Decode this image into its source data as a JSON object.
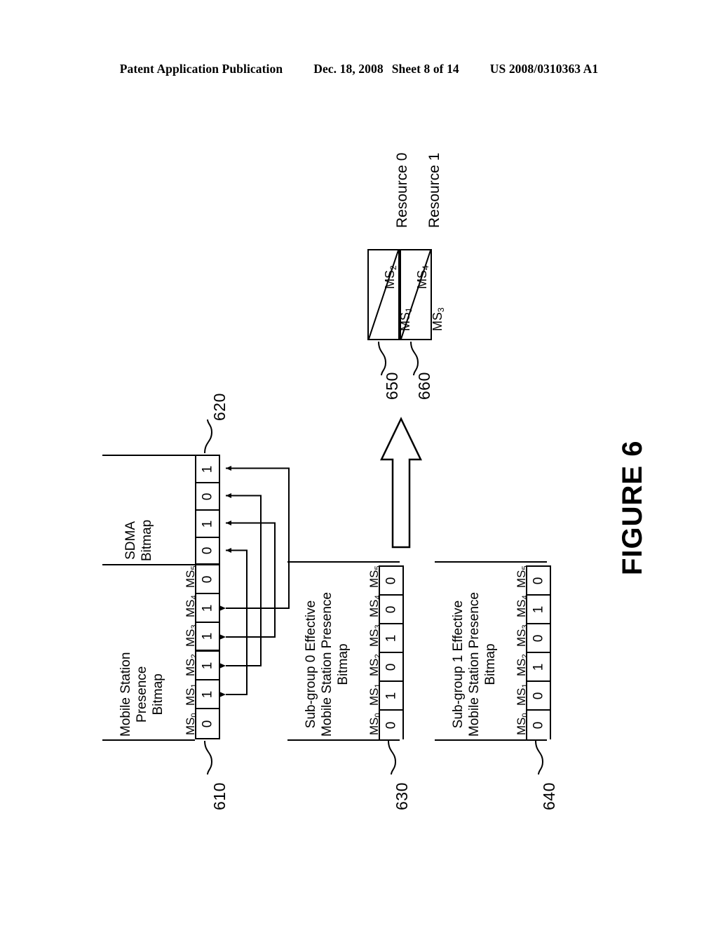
{
  "header": {
    "publication": "Patent Application Publication",
    "date": "Dec. 18, 2008",
    "sheet": "Sheet 8 of 14",
    "patent_number": "US 2008/0310363 A1"
  },
  "figure": {
    "title": "FIGURE 6"
  },
  "ms_column_headers": [
    "MS0",
    "MS1",
    "MS2",
    "MS3",
    "MS4",
    "MS5"
  ],
  "blocks": {
    "mobile_station_presence": {
      "ref": "610",
      "caption_lines": [
        "Mobile Station",
        "Presence",
        "Bitmap"
      ],
      "labels": [
        "MS0",
        "MS1",
        "MS2",
        "MS3",
        "MS4",
        "MS5"
      ],
      "values": [
        "0",
        "1",
        "1",
        "1",
        "1",
        "0"
      ]
    },
    "sdma_bitmap": {
      "ref": "620",
      "caption_lines": [
        "SDMA",
        "Bitmap"
      ],
      "values": [
        "0",
        "1",
        "0",
        "1"
      ]
    },
    "subgroup0": {
      "ref": "630",
      "caption_lines": [
        "Sub-group 0 Effective",
        "Mobile Station Presence",
        "Bitmap"
      ],
      "labels": [
        "MS0",
        "MS1",
        "MS2",
        "MS3",
        "MS4",
        "MS5"
      ],
      "values": [
        "0",
        "1",
        "0",
        "1",
        "0",
        "0"
      ]
    },
    "subgroup1": {
      "ref": "640",
      "caption_lines": [
        "Sub-group 1 Effective",
        "Mobile Station Presence",
        "Bitmap"
      ],
      "labels": [
        "MS0",
        "MS1",
        "MS2",
        "MS3",
        "MS4",
        "MS5"
      ],
      "values": [
        "0",
        "0",
        "1",
        "0",
        "1",
        "0"
      ]
    }
  },
  "resources": [
    {
      "ref": "650",
      "label": "Resource 0",
      "stations": [
        "MS1",
        "MS2"
      ]
    },
    {
      "ref": "660",
      "label": "Resource 1",
      "stations": [
        "MS3",
        "MS4"
      ]
    }
  ],
  "colors": {
    "ink": "#000000",
    "paper": "#ffffff"
  }
}
